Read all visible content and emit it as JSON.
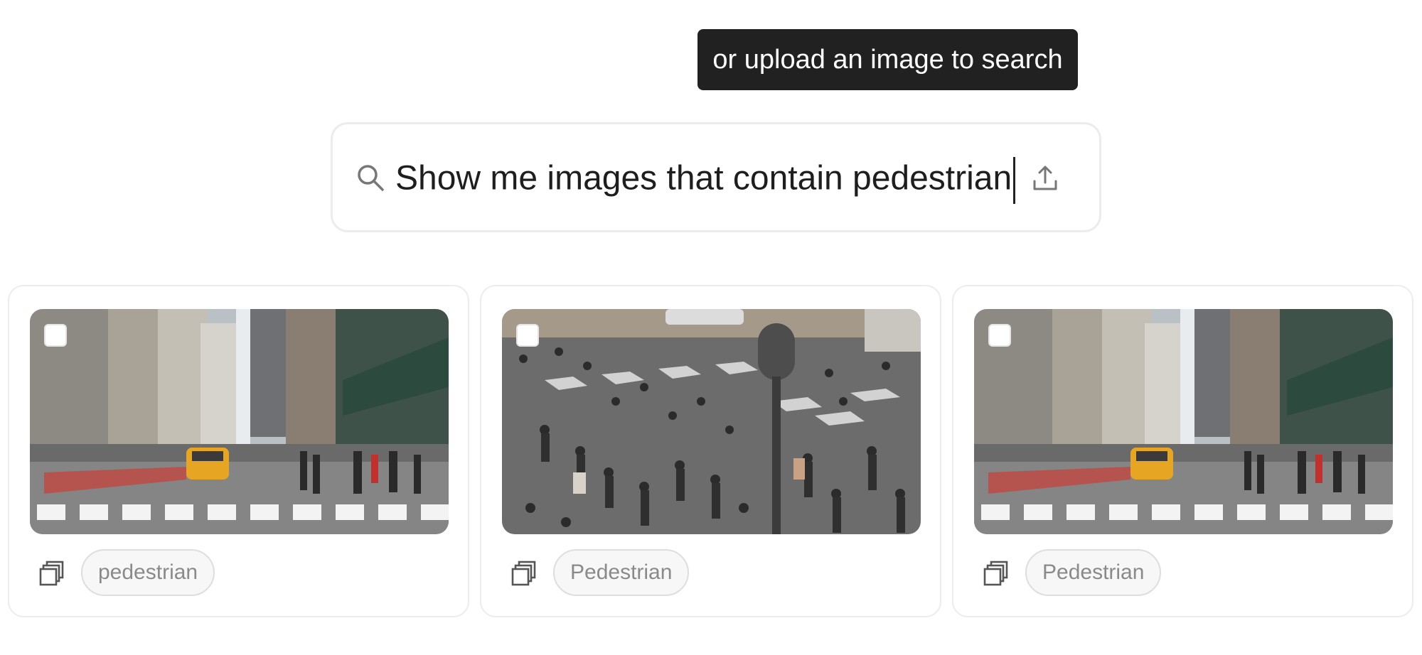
{
  "tooltip": {
    "text": "or upload an image to search"
  },
  "search": {
    "query": "Show me images that contain pedestrian",
    "icon": "search-icon",
    "upload_icon": "upload-icon"
  },
  "results": [
    {
      "tag": "pedestrian",
      "image": "city street crosswalk with yellow taxi and pedestrians",
      "icon": "copy-icon"
    },
    {
      "tag": "Pedestrian",
      "image": "crowded intersection with many pedestrians",
      "icon": "copy-icon"
    },
    {
      "tag": "Pedestrian",
      "image": "city street crosswalk with yellow taxi and pedestrians",
      "icon": "copy-icon"
    }
  ]
}
